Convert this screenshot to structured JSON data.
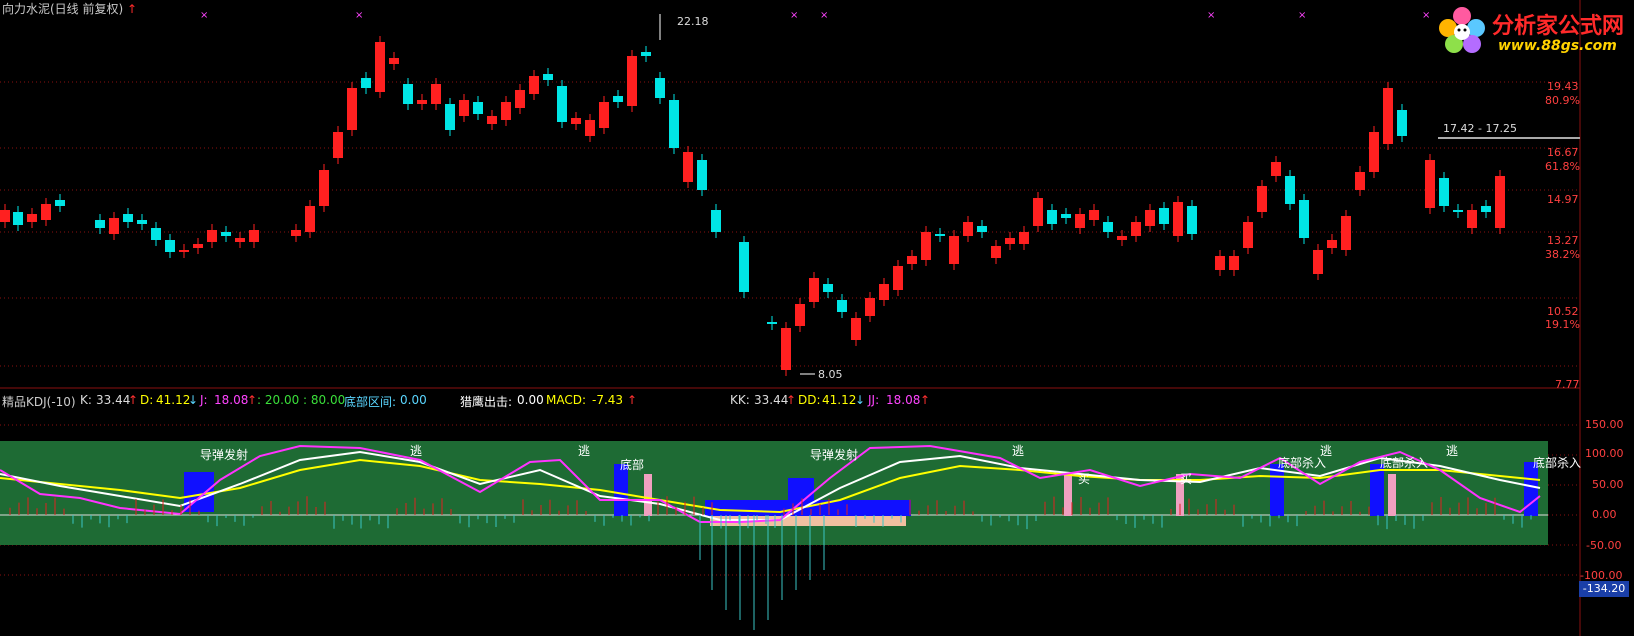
{
  "title": {
    "stock": "向力水泥(日线 前复权)",
    "arrow": "↑"
  },
  "logo": {
    "text": "分析家公式网",
    "url": "www.88gs.com"
  },
  "price_axis": [
    {
      "price": "19.43",
      "pct": "80.9%"
    },
    {
      "price": "16.67",
      "pct": "61.8%"
    },
    {
      "price": "14.97",
      "pct": ""
    },
    {
      "price": "13.27",
      "pct": "38.2%"
    },
    {
      "price": "10.52",
      "pct": "19.1%"
    },
    {
      "price": "7.77",
      "pct": ""
    }
  ],
  "annotations": {
    "high": "22.18",
    "low": "8.05",
    "range": "17.42 - 17.25"
  },
  "indicator_bar": {
    "name": "精品KDJ(-10)",
    "k_label": "K:",
    "k_val": "33.44",
    "k_arrow": "↑",
    "d_label": "D:",
    "d_val": "41.12",
    "d_arrow": "↓",
    "j_label": "J:",
    "j_val": "18.08",
    "j_arrow": "↑",
    "levels": ": 20.00 : 80.00",
    "bottom_label": "底部区间:",
    "bottom_val": "0.00",
    "hunt_label": "猎鹰出击:",
    "hunt_val": "0.00",
    "macd_label": "MACD:",
    "macd_val": "-7.43",
    "macd_arrow": "↑",
    "kk_label": "KK:",
    "kk_val": "33.44",
    "kk_arrow": "↑",
    "dd_label": "DD:",
    "dd_val": "41.12",
    "dd_arrow": "↓",
    "jj_label": "JJ:",
    "jj_val": "18.08",
    "jj_arrow": "↑"
  },
  "sub_axis": [
    "150.00",
    "100.00",
    "50.00",
    "0.00",
    "-50.00",
    "-100.00"
  ],
  "sub_axis_min": "-134.20",
  "signal_labels": {
    "launch": "导弹发射",
    "escape": "逃",
    "bottom": "底部",
    "buy": "买",
    "kill": "底部杀入",
    "bottom_short": "底部",
    "bottom_kill": "底部杀入"
  },
  "colors": {
    "up": "#ff2020",
    "down": "#00e5e5",
    "bg": "#000000",
    "band": "#1e6b34",
    "k": "#ffffff",
    "d": "#ffff00",
    "j": "#ff33ff"
  }
}
